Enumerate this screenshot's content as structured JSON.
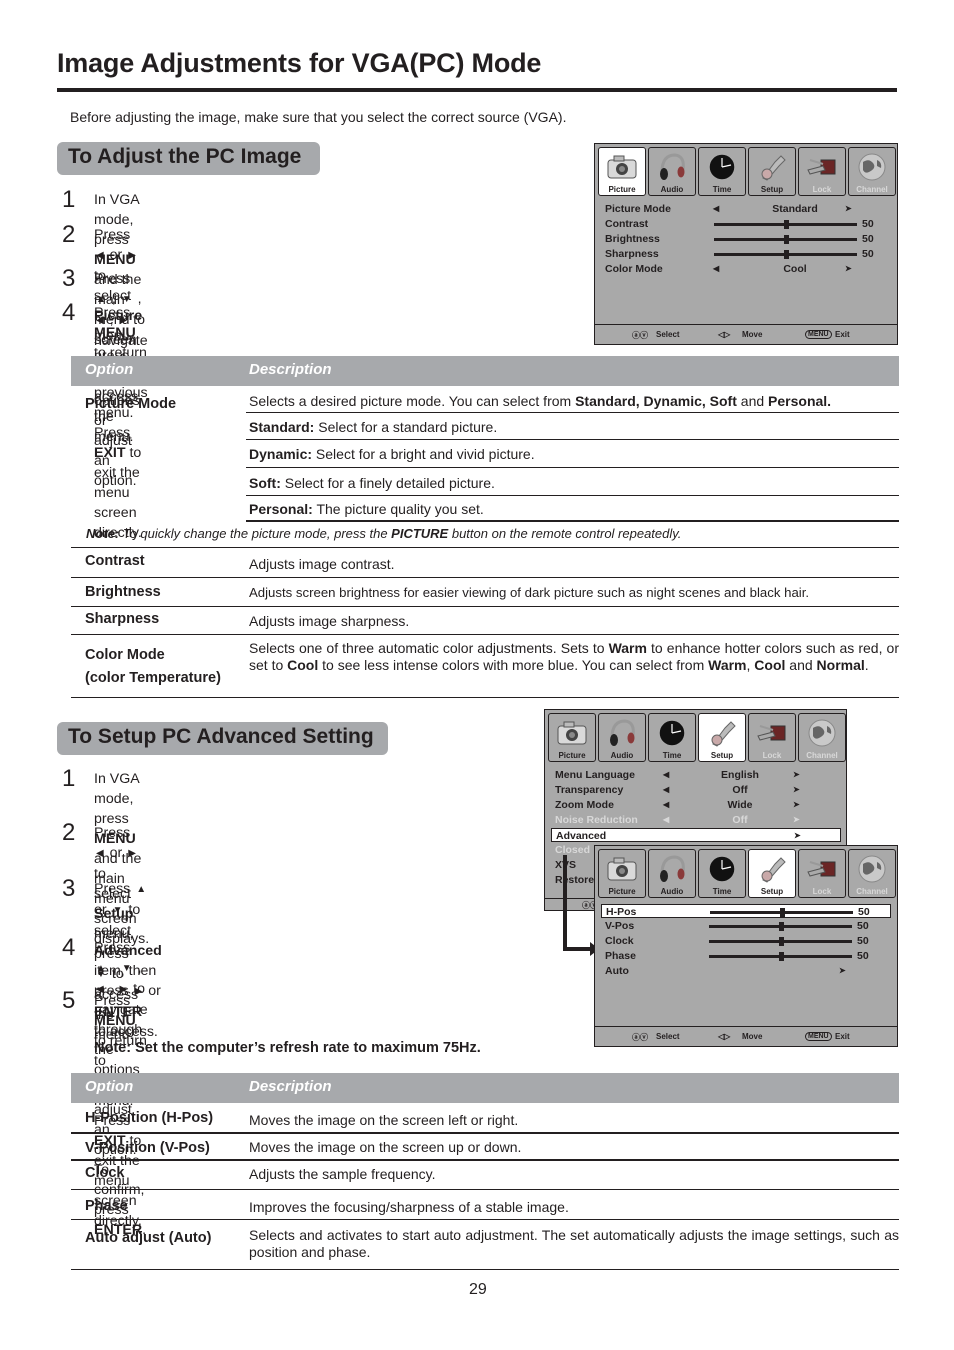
{
  "page": {
    "title": "Image Adjustments for VGA(PC) Mode",
    "intro": "Before adjusting the image, make sure that you select the correct source (VGA).",
    "page_number": "29"
  },
  "section1": {
    "heading": "To Adjust the PC Image",
    "steps": [
      {
        "num": "1",
        "parts": [
          "In VGA mode, press ",
          "MENU",
          " and the main menu screen displays."
        ]
      },
      {
        "num": "2",
        "parts": [
          "Press ",
          "◀",
          " or ",
          "▶",
          " to select ",
          "Picture",
          " menu,  press ",
          "▼",
          " to access the menu."
        ]
      },
      {
        "num": "3",
        "parts": [
          "Press ",
          "▲",
          " , ",
          "▼",
          " , ",
          "◀",
          " , ",
          "▶",
          "  to navigate through the options or adjust an option."
        ]
      },
      {
        "num": "4",
        "parts": [
          "Press ",
          "MENU",
          " to return to previous menu. Press ",
          "EXIT",
          " to exit the menu",
          "screen directly."
        ]
      }
    ],
    "table": {
      "header_option": "Option",
      "header_description": "Description",
      "picture_mode": {
        "label": "Picture Mode",
        "intro": [
          "Selects a desired picture mode. You can select from ",
          "Standard, Dynamic, Soft",
          " and ",
          "Personal."
        ],
        "sub": [
          {
            "name": "Standard:",
            "text": " Select for a standard picture."
          },
          {
            "name": "Dynamic:",
            "text": " Select for a bright and vivid picture."
          },
          {
            "name": "Soft:",
            "text": " Select for a finely detailed picture."
          },
          {
            "name": "Personal:",
            "text": " The picture quality you set."
          }
        ]
      },
      "note": {
        "label": "Note:",
        "pre": " To quickly change the picture mode, press the ",
        "key": "PICTURE",
        "post": " button on the remote control repeatedly."
      },
      "rows": [
        {
          "label": "Contrast",
          "desc": "Adjusts image contrast."
        },
        {
          "label": "Brightness",
          "desc": "Adjusts screen brightness for easier viewing of dark picture such as night scenes and black hair."
        },
        {
          "label": "Sharpness",
          "desc": "Adjusts image sharpness."
        }
      ],
      "color_mode": {
        "label_line1": "Color Mode",
        "label_line2": "(color Temperature)",
        "parts": [
          "Selects one of three automatic color adjustments.  Sets to ",
          "Warm",
          " to enhance hotter colors such as red,  or set to ",
          "Cool",
          " to see less intense colors with more blue.  You can select from ",
          "Warm",
          ", ",
          "Cool",
          " and ",
          "Normal",
          "."
        ]
      }
    }
  },
  "osd_picture": {
    "tabs": [
      {
        "label": "Picture",
        "icon": "camera-icon",
        "active": true,
        "dim": false
      },
      {
        "label": "Audio",
        "icon": "headphones-icon",
        "active": false,
        "dim": false
      },
      {
        "label": "Time",
        "icon": "clock-icon",
        "active": false,
        "dim": false
      },
      {
        "label": "Setup",
        "icon": "tools-icon",
        "active": false,
        "dim": false
      },
      {
        "label": "Lock",
        "icon": "key-lock-icon",
        "active": false,
        "dim": true
      },
      {
        "label": "Channel",
        "icon": "globe-icon",
        "active": false,
        "dim": true
      }
    ],
    "items": [
      {
        "label": "Picture Mode",
        "type": "select",
        "value": "Standard"
      },
      {
        "label": "Contrast",
        "type": "slider",
        "value": "50",
        "level": 0.5
      },
      {
        "label": "Brightness",
        "type": "slider",
        "value": "50",
        "level": 0.5
      },
      {
        "label": "Sharpness",
        "type": "slider",
        "value": "50",
        "level": 0.5
      },
      {
        "label": "Color Mode",
        "type": "select",
        "value": "Cool"
      }
    ],
    "footer": {
      "select": "Select",
      "move": "Move",
      "menu_key": "MENU",
      "exit": "Exit"
    }
  },
  "section2": {
    "heading": "To Setup PC Advanced Setting",
    "steps": [
      {
        "num": "1",
        "parts": [
          "In VGA mode, press ",
          "MENU",
          " and the main menu screen displays."
        ]
      },
      {
        "num": "2",
        "parts": [
          "Press ",
          "◀",
          " or ",
          "▶",
          " to select ",
          "Setup",
          " menu,  press ",
          "▼",
          " to access the menu."
        ]
      },
      {
        "num": "3",
        "parts": [
          "Press ",
          "▲",
          " or ",
          "▼",
          "  to select ",
          "Advanced",
          " item, then press  ",
          "▶",
          " or ",
          "ENTER",
          "to access."
        ]
      },
      {
        "num": "4",
        "parts": [
          "Press  ",
          "▲",
          " , ",
          "▼",
          " , ",
          "◀",
          " , ",
          "▶",
          "  to navigate through the options or adjust an",
          "option. To confirm, press ",
          "ENTER",
          "."
        ]
      },
      {
        "num": "5",
        "parts": [
          "Press ",
          "MENU",
          " to return to previous menu. Press ",
          "EXIT",
          " to exit the",
          "menu screen directly."
        ]
      }
    ],
    "note": "Note: Set the computer’s refresh rate to maximum 75Hz.",
    "table": {
      "header_option": "Option",
      "header_description": "Description",
      "rows": [
        {
          "label": "H-Position (H-Pos)",
          "desc": "Moves the image on the screen left or right."
        },
        {
          "label": "V-Position (V-Pos)",
          "desc": "Moves the image on the screen up or down."
        },
        {
          "label": "Clock",
          "desc": "Adjusts the sample frequency."
        },
        {
          "label": "Phase",
          "desc": "Improves the focusing/sharpness of a stable image."
        },
        {
          "label": "Auto adjust (Auto)",
          "desc": "Selects and activates to start auto adjustment. The set automatically adjusts the image settings, such as position and phase."
        }
      ]
    }
  },
  "osd_setup": {
    "tabs": [
      {
        "label": "Picture",
        "icon": "camera-icon",
        "active": false,
        "dim": false
      },
      {
        "label": "Audio",
        "icon": "headphones-icon",
        "active": false,
        "dim": false
      },
      {
        "label": "Time",
        "icon": "clock-icon",
        "active": false,
        "dim": false
      },
      {
        "label": "Setup",
        "icon": "tools-icon",
        "active": true,
        "dim": false
      },
      {
        "label": "Lock",
        "icon": "key-lock-icon",
        "active": false,
        "dim": true
      },
      {
        "label": "Channel",
        "icon": "globe-icon",
        "active": false,
        "dim": true
      }
    ],
    "items": [
      {
        "label": "Menu Language",
        "type": "select",
        "value": "English",
        "dim": false
      },
      {
        "label": "Transparency",
        "type": "select",
        "value": "Off",
        "dim": false
      },
      {
        "label": "Zoom Mode",
        "type": "select",
        "value": "Wide",
        "dim": false
      },
      {
        "label": "Noise Reduction",
        "type": "select",
        "value": "Off",
        "dim": true
      },
      {
        "label": "Advanced",
        "type": "submenu",
        "value": "",
        "dim": false,
        "selected": true
      },
      {
        "label": "Closed",
        "type": "partial",
        "value": "",
        "dim": true
      },
      {
        "label": "XVS",
        "type": "partial",
        "value": "",
        "dim": false
      },
      {
        "label": "Restore",
        "type": "partial",
        "value": "",
        "dim": false
      }
    ]
  },
  "osd_advanced": {
    "tabs": [
      {
        "label": "Picture",
        "icon": "camera-icon",
        "active": false,
        "dim": false
      },
      {
        "label": "Audio",
        "icon": "headphones-icon",
        "active": false,
        "dim": false
      },
      {
        "label": "Time",
        "icon": "clock-icon",
        "active": false,
        "dim": false
      },
      {
        "label": "Setup",
        "icon": "tools-icon",
        "active": true,
        "dim": false
      },
      {
        "label": "Lock",
        "icon": "key-lock-icon",
        "active": false,
        "dim": true
      },
      {
        "label": "Channel",
        "icon": "globe-icon",
        "active": false,
        "dim": true
      }
    ],
    "items": [
      {
        "label": "H-Pos",
        "type": "slider",
        "value": "50",
        "level": 0.5,
        "selected": true
      },
      {
        "label": "V-Pos",
        "type": "slider",
        "value": "50",
        "level": 0.5
      },
      {
        "label": "Clock",
        "type": "slider",
        "value": "50",
        "level": 0.5
      },
      {
        "label": "Phase",
        "type": "slider",
        "value": "50",
        "level": 0.5
      },
      {
        "label": "Auto",
        "type": "submenu",
        "value": ""
      }
    ],
    "footer": {
      "select": "Select",
      "move": "Move",
      "menu_key": "MENU",
      "exit": "Exit"
    }
  }
}
